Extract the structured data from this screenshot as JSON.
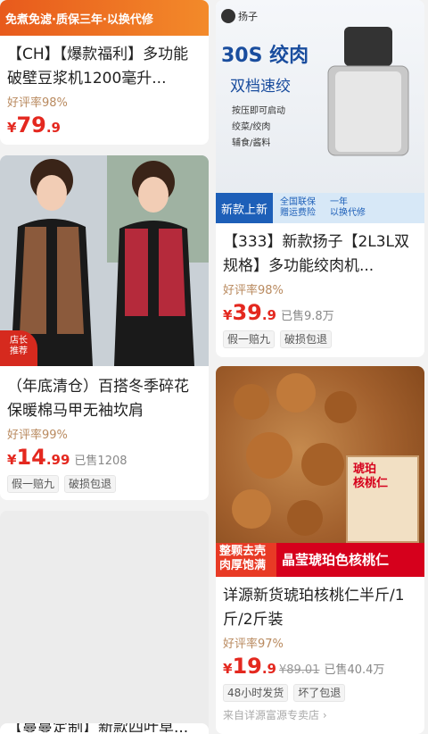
{
  "left": {
    "card1": {
      "banner": "免煮免滤·质保三年·以换代修",
      "title": "【CH】【爆款福利】多功能破壁豆浆机1200毫升...",
      "rating": "好评率98%",
      "price_currency": "¥",
      "price_int": "79",
      "price_dec": ".9"
    },
    "card2": {
      "badge": "店长\n推荐",
      "title": "（年底清仓）百搭冬季碎花保暖棉马甲无袖坎肩",
      "rating": "好评率99%",
      "price_currency": "¥",
      "price_int": "14",
      "price_dec": ".99",
      "sold": "已售1208",
      "tags": [
        "假一赔九",
        "破损包退"
      ]
    },
    "card4": {
      "title": "【蔓蔓定制】新款四叶草..."
    }
  },
  "right": {
    "card1": {
      "brand": "扬子",
      "headline": "30S 绞肉",
      "subhead": "双档速绞",
      "bullets": [
        "按压即可启动",
        "绞菜/绞肉",
        "辅食/酱料"
      ],
      "strip_new": "新款上新",
      "strip_item1": "全国联保\n赠运费险",
      "strip_item2": "一年\n以换代修",
      "title": "【333】新款扬子【2L3L双规格】多功能绞肉机...",
      "rating": "好评率98%",
      "price_currency": "¥",
      "price_int": "39",
      "price_dec": ".9",
      "sold": "已售9.8万",
      "tags": [
        "假一赔九",
        "破损包退"
      ]
    },
    "card2": {
      "banner_left": "整颗去壳\n肉厚饱满",
      "banner_right": "晶莹琥珀色核桃仁",
      "box_text": "琥珀\n核桃仁",
      "title": "详源新货琥珀核桃仁半斤/1斤/2斤装",
      "rating": "好评率97%",
      "price_currency": "¥",
      "price_int": "19",
      "price_dec": ".9",
      "orig_price": "¥89.01",
      "sold": "已售40.4万",
      "tags": [
        "48小时发货",
        "坏了包退"
      ],
      "shop": "来自详源富源专卖店 ›"
    }
  }
}
